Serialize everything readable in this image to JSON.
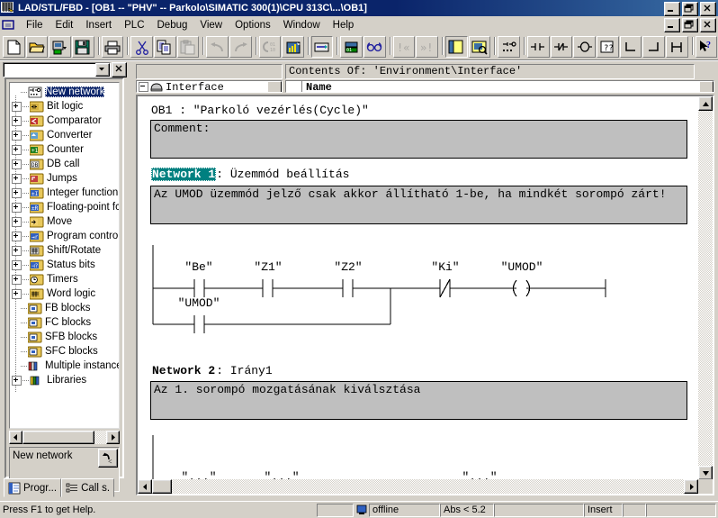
{
  "window": {
    "title": "LAD/STL/FBD  - [OB1 -- \"PHV\" -- Parkolo\\SIMATIC 300(1)\\CPU 313C\\...\\OB1]",
    "app_icon": "ladder-logic-icon",
    "minimize": "_",
    "maximize": "restore",
    "close": "X"
  },
  "menu": {
    "doc_icon": "document-control-icon",
    "items": [
      {
        "label": "File"
      },
      {
        "label": "Edit"
      },
      {
        "label": "Insert"
      },
      {
        "label": "PLC"
      },
      {
        "label": "Debug"
      },
      {
        "label": "View"
      },
      {
        "label": "Options"
      },
      {
        "label": "Window"
      },
      {
        "label": "Help"
      }
    ]
  },
  "toolbar": {
    "buttons": [
      {
        "name": "new-icon",
        "state": "enabled"
      },
      {
        "name": "open-icon",
        "state": "enabled"
      },
      {
        "name": "save-as-icon",
        "state": "enabled"
      },
      {
        "name": "save-icon",
        "state": "enabled"
      },
      {
        "name": "print-icon",
        "state": "enabled"
      },
      {
        "name": "cut-icon",
        "state": "enabled"
      },
      {
        "name": "copy-icon",
        "state": "enabled"
      },
      {
        "name": "paste-icon",
        "state": "disabled"
      },
      {
        "name": "undo-icon",
        "state": "disabled"
      },
      {
        "name": "redo-icon",
        "state": "disabled"
      },
      {
        "name": "download-to-plc-icon",
        "state": "disabled"
      },
      {
        "name": "monitor-icon",
        "state": "enabled"
      },
      {
        "name": "symbol-table-icon",
        "state": "enabled"
      },
      {
        "name": "symbolic-representation-icon",
        "state": "enabled"
      },
      {
        "name": "glasses-overview-icon",
        "state": "enabled"
      },
      {
        "name": "goto-previous-error-icon",
        "state": "disabled"
      },
      {
        "name": "goto-next-error-icon",
        "state": "disabled"
      },
      {
        "name": "program-elements-icon",
        "state": "pressed"
      },
      {
        "name": "call-structure-icon",
        "state": "enabled"
      },
      {
        "name": "new-network-icon",
        "state": "enabled"
      },
      {
        "name": "normally-open-contact-icon",
        "state": "enabled"
      },
      {
        "name": "normally-closed-contact-icon",
        "state": "enabled"
      },
      {
        "name": "output-coil-icon",
        "state": "enabled"
      },
      {
        "name": "empty-box-icon",
        "state": "enabled"
      },
      {
        "name": "open-branch-icon",
        "state": "enabled"
      },
      {
        "name": "close-branch-icon",
        "state": "enabled"
      },
      {
        "name": "connector-icon",
        "state": "enabled"
      },
      {
        "name": "help-pointer-icon",
        "state": "enabled"
      }
    ]
  },
  "left_panel": {
    "combo_value": "",
    "close_label": "×",
    "up_icon": "up-one-level-icon",
    "status_text": "New network",
    "tree": [
      {
        "label": "New network",
        "icon": "new-network-icon",
        "expandable": false,
        "selected": true
      },
      {
        "label": "Bit logic",
        "icon": "bit-logic-folder-icon",
        "expandable": true,
        "selected": false
      },
      {
        "label": "Comparator",
        "icon": "comparator-folder-icon",
        "expandable": true,
        "selected": false
      },
      {
        "label": "Converter",
        "icon": "converter-folder-icon",
        "expandable": true,
        "selected": false
      },
      {
        "label": "Counter",
        "icon": "counter-folder-icon",
        "expandable": true,
        "selected": false
      },
      {
        "label": "DB call",
        "icon": "db-call-folder-icon",
        "expandable": true,
        "selected": false
      },
      {
        "label": "Jumps",
        "icon": "jumps-folder-icon",
        "expandable": true,
        "selected": false
      },
      {
        "label": "Integer function",
        "icon": "integer-function-folder-icon",
        "expandable": true,
        "selected": false
      },
      {
        "label": "Floating-point fct.",
        "icon": "floating-point-folder-icon",
        "expandable": true,
        "selected": false
      },
      {
        "label": "Move",
        "icon": "move-folder-icon",
        "expandable": true,
        "selected": false
      },
      {
        "label": "Program control",
        "icon": "program-control-folder-icon",
        "expandable": true,
        "selected": false
      },
      {
        "label": "Shift/Rotate",
        "icon": "shift-rotate-folder-icon",
        "expandable": true,
        "selected": false
      },
      {
        "label": "Status bits",
        "icon": "status-bits-folder-icon",
        "expandable": true,
        "selected": false
      },
      {
        "label": "Timers",
        "icon": "timers-folder-icon",
        "expandable": true,
        "selected": false
      },
      {
        "label": "Word logic",
        "icon": "word-logic-folder-icon",
        "expandable": true,
        "selected": false
      },
      {
        "label": "FB blocks",
        "icon": "fb-blocks-icon",
        "expandable": false,
        "selected": false
      },
      {
        "label": "FC blocks",
        "icon": "fc-blocks-icon",
        "expandable": false,
        "selected": false
      },
      {
        "label": "SFB blocks",
        "icon": "sfb-blocks-icon",
        "expandable": false,
        "selected": false
      },
      {
        "label": "SFC blocks",
        "icon": "sfc-blocks-icon",
        "expandable": false,
        "selected": false
      },
      {
        "label": "Multiple instances",
        "icon": "multiple-instances-icon",
        "expandable": false,
        "selected": false
      },
      {
        "label": "Libraries",
        "icon": "libraries-icon",
        "expandable": true,
        "selected": false
      }
    ],
    "tabs": [
      {
        "label": "Progr...",
        "icon": "program-elements-tab-icon",
        "active": true
      },
      {
        "label": "Call s.",
        "icon": "call-structure-tab-icon",
        "active": false
      }
    ]
  },
  "editor": {
    "contents_of": "Contents Of: 'Environment\\Interface'",
    "interface_label": "Interface",
    "name_column": "Name",
    "block_title": "OB1 :   \"Parkoló vezérlés(Cycle)\"",
    "block_comment": "Comment:",
    "networks": [
      {
        "label": "Network 1",
        "separator": ":",
        "title": "Üzemmód beállítás",
        "selected": true,
        "comment": "Az UMOD üzemmód jelző csak akkor állítható 1-be, ha mindkét sorompó zárt!",
        "rungs": [
          {
            "row": 1,
            "elements": [
              {
                "type": "contact-no",
                "label": "\"Be\""
              },
              {
                "type": "contact-no",
                "label": "\"Z1\""
              },
              {
                "type": "contact-no",
                "label": "\"Z2\""
              },
              {
                "type": "contact-nc",
                "label": "\"Ki\""
              },
              {
                "type": "coil",
                "label": "\"UMOD\""
              }
            ]
          },
          {
            "row": 2,
            "branch": true,
            "elements": [
              {
                "type": "contact-no",
                "label": "\"UMOD\""
              }
            ]
          }
        ]
      },
      {
        "label": "Network 2",
        "separator": ":",
        "title": "Irány1",
        "selected": false,
        "comment": "Az 1. sorompó mozgatásának kiválsztása",
        "rungs": []
      }
    ]
  },
  "status_bar": {
    "help_text": "Press F1 to get Help.",
    "cell_connection_icon": "plc-connection-icon",
    "mode": "offline",
    "address": "Abs < 5.2",
    "blank1": "",
    "insert_mode": "Insert",
    "blank2": "",
    "blank3": ""
  },
  "colors": {
    "title_active": "#0a246a",
    "face": "#d4d0c8",
    "network_highlight": "#008080",
    "tree_selection": "#0a246a",
    "comment_box": "#bfbfbf"
  }
}
